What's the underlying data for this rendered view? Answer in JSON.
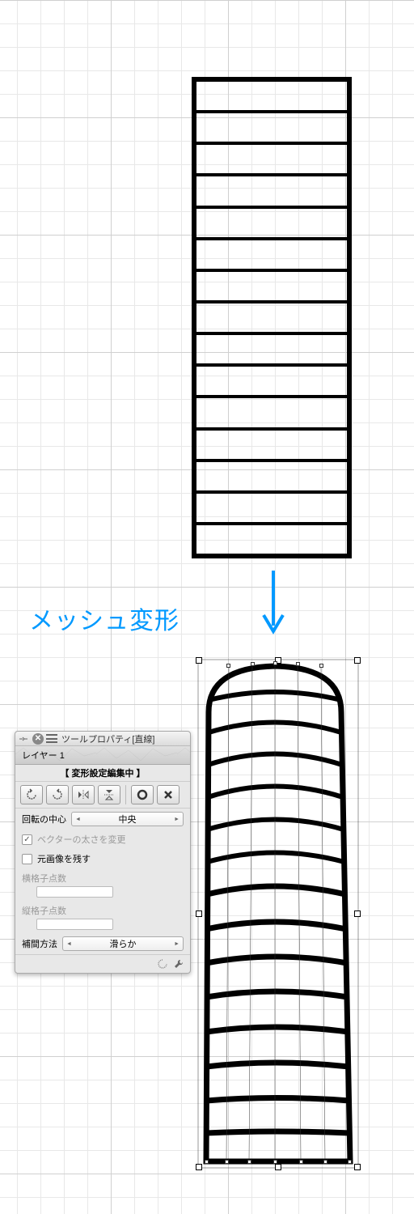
{
  "annotation": "メッシュ変形",
  "panel": {
    "title": "ツールプロパティ[直線]",
    "layer_tab": "レイヤー 1",
    "transform_label": "【 変形設定編集中 】",
    "rotation_center_label": "回転の中心",
    "rotation_center_value": "中央",
    "vector_thickness_label": "ベクターの太さを変更",
    "keep_original_label": "元画像を残す",
    "horizontal_grid_label": "横格子点数",
    "vertical_grid_label": "縦格子点数",
    "interpolation_label": "補間方法",
    "interpolation_value": "滑らか"
  }
}
